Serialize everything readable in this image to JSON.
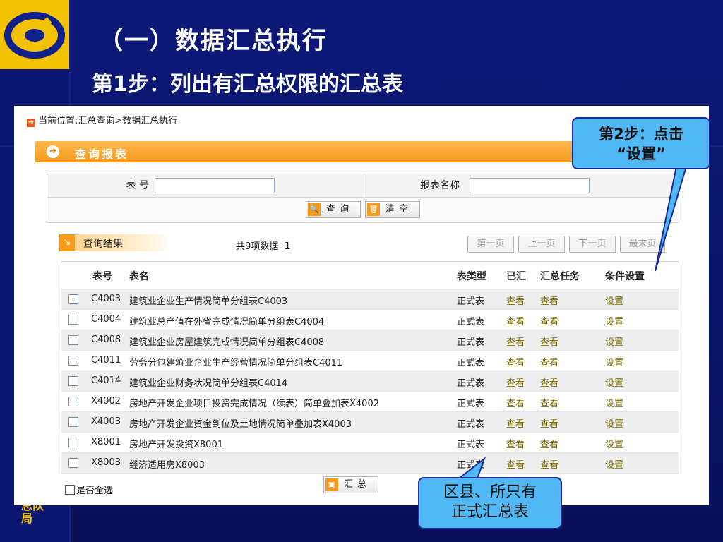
{
  "slide": {
    "title": "（一）数据汇总执行",
    "subtitle": "第1步：列出有汇总权限的汇总表",
    "side_text": "总队局"
  },
  "breadcrumb": "当前位置:汇总查询>数据汇总执行",
  "query_panel": {
    "title": "查询报表",
    "table_no_label": "表  号",
    "table_name_label": "报表名称",
    "table_no_value": "",
    "table_name_value": "",
    "search_button": "查询",
    "clear_button": "清空"
  },
  "results": {
    "title": "查询结果",
    "count_text": "共9项数据",
    "page_number": "1",
    "pagination": [
      "第一页",
      "上一页",
      "下一页",
      "最末页"
    ],
    "columns": [
      "表号",
      "表名",
      "表类型",
      "已汇",
      "汇总任务",
      "条件设置"
    ],
    "rows": [
      {
        "code": "C4003",
        "name": "建筑业企业生产情况简单分组表C4003",
        "type": "正式表",
        "done": "查看",
        "task": "查看",
        "cond": "设置"
      },
      {
        "code": "C4004",
        "name": "建筑业总产值在外省完成情况简单分组表C4004",
        "type": "正式表",
        "done": "查看",
        "task": "查看",
        "cond": "设置"
      },
      {
        "code": "C4008",
        "name": "建筑业企业房屋建筑完成情况简单分组表C4008",
        "type": "正式表",
        "done": "查看",
        "task": "查看",
        "cond": "设置"
      },
      {
        "code": "C4011",
        "name": "劳务分包建筑业企业生产经营情况简单分组表C4011",
        "type": "正式表",
        "done": "查看",
        "task": "查看",
        "cond": "设置"
      },
      {
        "code": "C4014",
        "name": "建筑业企业财务状况简单分组表C4014",
        "type": "正式表",
        "done": "查看",
        "task": "查看",
        "cond": "设置"
      },
      {
        "code": "X4002",
        "name": "房地产开发企业项目投资完成情况（续表）简单叠加表X4002",
        "type": "正式表",
        "done": "查看",
        "task": "查看",
        "cond": "设置"
      },
      {
        "code": "X4003",
        "name": "房地产开发企业资金到位及土地情况简单叠加表X4003",
        "type": "正式表",
        "done": "查看",
        "task": "查看",
        "cond": "设置"
      },
      {
        "code": "X8001",
        "name": "房地产开发投资X8001",
        "type": "正式表",
        "done": "查看",
        "task": "查看",
        "cond": "设置"
      },
      {
        "code": "X8003",
        "name": "经济适用房X8003",
        "type": "正式表",
        "done": "查看",
        "task": "查看",
        "cond": "设置"
      }
    ],
    "select_all_label": "是否全选",
    "summary_button": "汇总"
  },
  "callouts": {
    "step2_line1": "第2步：点击",
    "step2_line2": "“设置”",
    "note_line1": "区县、所只有",
    "note_line2": "正式汇总表"
  },
  "colors": {
    "slide_bg": "#0a1466",
    "accent_orange": "#f59a1a",
    "callout_blue": "#4fb8f5",
    "logo_yellow": "#f2c200"
  }
}
